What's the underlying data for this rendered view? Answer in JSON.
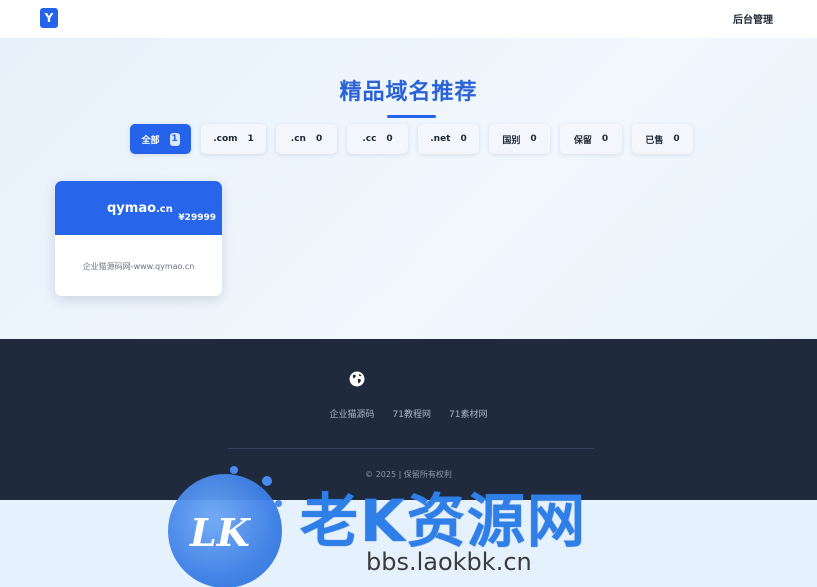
{
  "header": {
    "logo_letter": "Y",
    "admin_label": "后台管理"
  },
  "main": {
    "title": "精品域名推荐",
    "tabs": [
      {
        "label": "全部",
        "count": "1",
        "active": true
      },
      {
        "label": ".com",
        "count": "1",
        "active": false
      },
      {
        "label": ".cn",
        "count": "0",
        "active": false
      },
      {
        "label": ".cc",
        "count": "0",
        "active": false
      },
      {
        "label": ".net",
        "count": "0",
        "active": false
      },
      {
        "label": "国别",
        "count": "0",
        "active": false
      },
      {
        "label": "保留",
        "count": "0",
        "active": false
      },
      {
        "label": "已售",
        "count": "0",
        "active": false
      }
    ],
    "domains": [
      {
        "name": "qymao",
        "tld": ".cn",
        "price": "¥29999",
        "desc": "企业猫源码网-www.qymao.cn"
      }
    ]
  },
  "footer": {
    "links": [
      "企业猫源码",
      "71教程网",
      "71素材网"
    ],
    "copyright": "© 2025 | 保留所有权利"
  },
  "watermark": {
    "badge": "LK",
    "title": "老K资源网",
    "url": "bbs.laokbk.cn"
  },
  "colors": {
    "accent": "#2563eb",
    "footer_bg": "#1f2a3d",
    "title": "#2b63d6"
  }
}
